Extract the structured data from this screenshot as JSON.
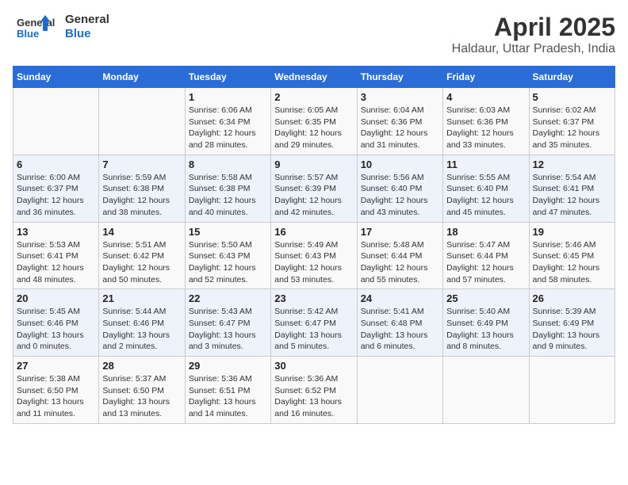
{
  "logo": {
    "line1": "General",
    "line2": "Blue"
  },
  "title": "April 2025",
  "subtitle": "Haldaur, Uttar Pradesh, India",
  "days_header": [
    "Sunday",
    "Monday",
    "Tuesday",
    "Wednesday",
    "Thursday",
    "Friday",
    "Saturday"
  ],
  "weeks": [
    [
      {
        "day": "",
        "info": ""
      },
      {
        "day": "",
        "info": ""
      },
      {
        "day": "1",
        "info": "Sunrise: 6:06 AM\nSunset: 6:34 PM\nDaylight: 12 hours and 28 minutes."
      },
      {
        "day": "2",
        "info": "Sunrise: 6:05 AM\nSunset: 6:35 PM\nDaylight: 12 hours and 29 minutes."
      },
      {
        "day": "3",
        "info": "Sunrise: 6:04 AM\nSunset: 6:36 PM\nDaylight: 12 hours and 31 minutes."
      },
      {
        "day": "4",
        "info": "Sunrise: 6:03 AM\nSunset: 6:36 PM\nDaylight: 12 hours and 33 minutes."
      },
      {
        "day": "5",
        "info": "Sunrise: 6:02 AM\nSunset: 6:37 PM\nDaylight: 12 hours and 35 minutes."
      }
    ],
    [
      {
        "day": "6",
        "info": "Sunrise: 6:00 AM\nSunset: 6:37 PM\nDaylight: 12 hours and 36 minutes."
      },
      {
        "day": "7",
        "info": "Sunrise: 5:59 AM\nSunset: 6:38 PM\nDaylight: 12 hours and 38 minutes."
      },
      {
        "day": "8",
        "info": "Sunrise: 5:58 AM\nSunset: 6:38 PM\nDaylight: 12 hours and 40 minutes."
      },
      {
        "day": "9",
        "info": "Sunrise: 5:57 AM\nSunset: 6:39 PM\nDaylight: 12 hours and 42 minutes."
      },
      {
        "day": "10",
        "info": "Sunrise: 5:56 AM\nSunset: 6:40 PM\nDaylight: 12 hours and 43 minutes."
      },
      {
        "day": "11",
        "info": "Sunrise: 5:55 AM\nSunset: 6:40 PM\nDaylight: 12 hours and 45 minutes."
      },
      {
        "day": "12",
        "info": "Sunrise: 5:54 AM\nSunset: 6:41 PM\nDaylight: 12 hours and 47 minutes."
      }
    ],
    [
      {
        "day": "13",
        "info": "Sunrise: 5:53 AM\nSunset: 6:41 PM\nDaylight: 12 hours and 48 minutes."
      },
      {
        "day": "14",
        "info": "Sunrise: 5:51 AM\nSunset: 6:42 PM\nDaylight: 12 hours and 50 minutes."
      },
      {
        "day": "15",
        "info": "Sunrise: 5:50 AM\nSunset: 6:43 PM\nDaylight: 12 hours and 52 minutes."
      },
      {
        "day": "16",
        "info": "Sunrise: 5:49 AM\nSunset: 6:43 PM\nDaylight: 12 hours and 53 minutes."
      },
      {
        "day": "17",
        "info": "Sunrise: 5:48 AM\nSunset: 6:44 PM\nDaylight: 12 hours and 55 minutes."
      },
      {
        "day": "18",
        "info": "Sunrise: 5:47 AM\nSunset: 6:44 PM\nDaylight: 12 hours and 57 minutes."
      },
      {
        "day": "19",
        "info": "Sunrise: 5:46 AM\nSunset: 6:45 PM\nDaylight: 12 hours and 58 minutes."
      }
    ],
    [
      {
        "day": "20",
        "info": "Sunrise: 5:45 AM\nSunset: 6:46 PM\nDaylight: 13 hours and 0 minutes."
      },
      {
        "day": "21",
        "info": "Sunrise: 5:44 AM\nSunset: 6:46 PM\nDaylight: 13 hours and 2 minutes."
      },
      {
        "day": "22",
        "info": "Sunrise: 5:43 AM\nSunset: 6:47 PM\nDaylight: 13 hours and 3 minutes."
      },
      {
        "day": "23",
        "info": "Sunrise: 5:42 AM\nSunset: 6:47 PM\nDaylight: 13 hours and 5 minutes."
      },
      {
        "day": "24",
        "info": "Sunrise: 5:41 AM\nSunset: 6:48 PM\nDaylight: 13 hours and 6 minutes."
      },
      {
        "day": "25",
        "info": "Sunrise: 5:40 AM\nSunset: 6:49 PM\nDaylight: 13 hours and 8 minutes."
      },
      {
        "day": "26",
        "info": "Sunrise: 5:39 AM\nSunset: 6:49 PM\nDaylight: 13 hours and 9 minutes."
      }
    ],
    [
      {
        "day": "27",
        "info": "Sunrise: 5:38 AM\nSunset: 6:50 PM\nDaylight: 13 hours and 11 minutes."
      },
      {
        "day": "28",
        "info": "Sunrise: 5:37 AM\nSunset: 6:50 PM\nDaylight: 13 hours and 13 minutes."
      },
      {
        "day": "29",
        "info": "Sunrise: 5:36 AM\nSunset: 6:51 PM\nDaylight: 13 hours and 14 minutes."
      },
      {
        "day": "30",
        "info": "Sunrise: 5:36 AM\nSunset: 6:52 PM\nDaylight: 13 hours and 16 minutes."
      },
      {
        "day": "",
        "info": ""
      },
      {
        "day": "",
        "info": ""
      },
      {
        "day": "",
        "info": ""
      }
    ]
  ]
}
